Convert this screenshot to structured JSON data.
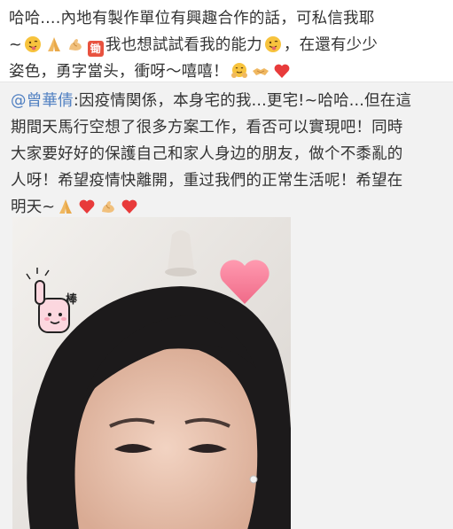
{
  "post": {
    "line1": "哈哈....內地有製作單位有興趣合作的話，可私信我耶",
    "line2_start": "~",
    "line2_end": "我也想試試看我的能力",
    "line2_tail": "，在還有少少",
    "line3": "姿色，勇字當头，衝呀～嘻嘻！",
    "link_badge": "锄"
  },
  "repost": {
    "mention": "@曾華倩",
    "line1_rest": ":因疫情関係，本身宅的我...更宅!~哈哈...但在這",
    "line2": "期間天馬行空想了很多方案工作，看否可以實現吧！同時",
    "line3": "大家要好好的保護自己和家人身边的朋友，做个不黍亂的",
    "line4": "人呀！希望疫情快離開，重过我們的正常生活呢！希望在",
    "line5": "明天~"
  },
  "photo": {
    "sticker_text": "棒"
  },
  "colors": {
    "link": "#4f7fc1",
    "text": "#333333",
    "repost_bg": "#f2f2f2",
    "heart": "#e83b3b"
  },
  "icons": [
    "tongue-face-icon",
    "pray-icon",
    "muscle-icon",
    "link-badge-icon",
    "hug-face-icon",
    "handshake-icon",
    "heart-icon"
  ]
}
